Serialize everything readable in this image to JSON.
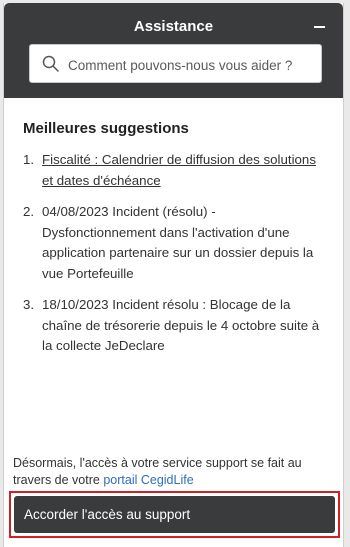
{
  "header": {
    "title": "Assistance",
    "search_placeholder": "Comment pouvons-nous vous aider ?"
  },
  "suggestions": {
    "heading": "Meilleures suggestions",
    "items": [
      {
        "number": "1.",
        "text": "Fiscalité : Calendrier de diffusion des solutions et dates d'échéance"
      },
      {
        "number": "2.",
        "text": "04/08/2023 Incident (résolu) - Dysfonctionnement dans l'activation d'une application partenaire sur un dossier depuis la vue Portefeuille"
      },
      {
        "number": "3.",
        "text": "18/10/2023 Incident résolu : Blocage de la chaîne de trésorerie depuis le 4 octobre suite à la collecte JeDeclare"
      }
    ]
  },
  "footer": {
    "note_prefix": "Désormais, l'accès à votre service support se fait au travers de votre",
    "note_link": "portail CegidLife",
    "button_label": "Accorder l'accès au support"
  },
  "colors": {
    "header_bg": "#3a3b3d",
    "highlight_border": "#d02026",
    "link": "#2f6fba"
  }
}
